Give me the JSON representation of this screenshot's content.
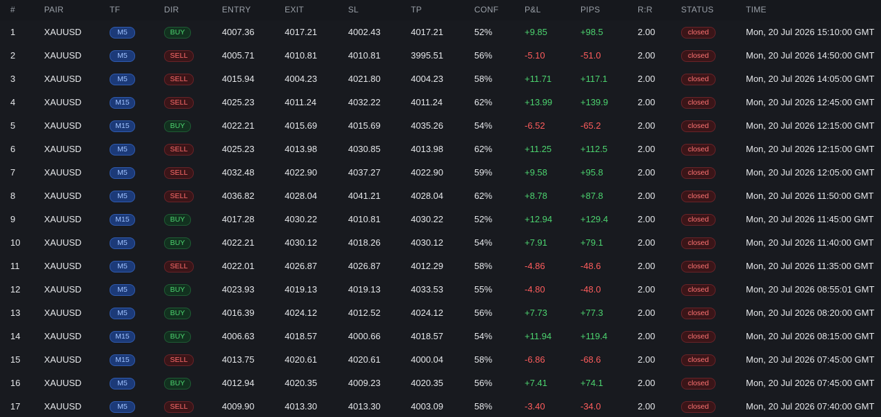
{
  "headers": {
    "num": "#",
    "pair": "PAIR",
    "tf": "TF",
    "dir": "DIR",
    "entry": "ENTRY",
    "exit": "EXIT",
    "sl": "SL",
    "tp": "TP",
    "conf": "CONF",
    "pnl": "P&L",
    "pips": "PIPS",
    "rr": "R:R",
    "status": "STATUS",
    "time": "TIME"
  },
  "colors": {
    "background": "#16181d",
    "positive": "#4cd46f",
    "negative": "#ff5d5d",
    "tf_badge": "#1c3a78",
    "buy_badge": "#12311f",
    "sell_badge": "#3a1518"
  },
  "rows": [
    {
      "num": "1",
      "pair": "XAUUSD",
      "tf": "M5",
      "dir": "BUY",
      "entry": "4007.36",
      "exit": "4017.21",
      "sl": "4002.43",
      "tp": "4017.21",
      "conf": "52%",
      "pnl": "+9.85",
      "pips": "+98.5",
      "rr": "2.00",
      "status": "closed",
      "time": "Mon, 20 Jul 2026 15:10:00 GMT"
    },
    {
      "num": "2",
      "pair": "XAUUSD",
      "tf": "M5",
      "dir": "SELL",
      "entry": "4005.71",
      "exit": "4010.81",
      "sl": "4010.81",
      "tp": "3995.51",
      "conf": "56%",
      "pnl": "-5.10",
      "pips": "-51.0",
      "rr": "2.00",
      "status": "closed",
      "time": "Mon, 20 Jul 2026 14:50:00 GMT"
    },
    {
      "num": "3",
      "pair": "XAUUSD",
      "tf": "M5",
      "dir": "SELL",
      "entry": "4015.94",
      "exit": "4004.23",
      "sl": "4021.80",
      "tp": "4004.23",
      "conf": "58%",
      "pnl": "+11.71",
      "pips": "+117.1",
      "rr": "2.00",
      "status": "closed",
      "time": "Mon, 20 Jul 2026 14:05:00 GMT"
    },
    {
      "num": "4",
      "pair": "XAUUSD",
      "tf": "M15",
      "dir": "SELL",
      "entry": "4025.23",
      "exit": "4011.24",
      "sl": "4032.22",
      "tp": "4011.24",
      "conf": "62%",
      "pnl": "+13.99",
      "pips": "+139.9",
      "rr": "2.00",
      "status": "closed",
      "time": "Mon, 20 Jul 2026 12:45:00 GMT"
    },
    {
      "num": "5",
      "pair": "XAUUSD",
      "tf": "M15",
      "dir": "BUY",
      "entry": "4022.21",
      "exit": "4015.69",
      "sl": "4015.69",
      "tp": "4035.26",
      "conf": "54%",
      "pnl": "-6.52",
      "pips": "-65.2",
      "rr": "2.00",
      "status": "closed",
      "time": "Mon, 20 Jul 2026 12:15:00 GMT"
    },
    {
      "num": "6",
      "pair": "XAUUSD",
      "tf": "M5",
      "dir": "SELL",
      "entry": "4025.23",
      "exit": "4013.98",
      "sl": "4030.85",
      "tp": "4013.98",
      "conf": "62%",
      "pnl": "+11.25",
      "pips": "+112.5",
      "rr": "2.00",
      "status": "closed",
      "time": "Mon, 20 Jul 2026 12:15:00 GMT"
    },
    {
      "num": "7",
      "pair": "XAUUSD",
      "tf": "M5",
      "dir": "SELL",
      "entry": "4032.48",
      "exit": "4022.90",
      "sl": "4037.27",
      "tp": "4022.90",
      "conf": "59%",
      "pnl": "+9.58",
      "pips": "+95.8",
      "rr": "2.00",
      "status": "closed",
      "time": "Mon, 20 Jul 2026 12:05:00 GMT"
    },
    {
      "num": "8",
      "pair": "XAUUSD",
      "tf": "M5",
      "dir": "SELL",
      "entry": "4036.82",
      "exit": "4028.04",
      "sl": "4041.21",
      "tp": "4028.04",
      "conf": "62%",
      "pnl": "+8.78",
      "pips": "+87.8",
      "rr": "2.00",
      "status": "closed",
      "time": "Mon, 20 Jul 2026 11:50:00 GMT"
    },
    {
      "num": "9",
      "pair": "XAUUSD",
      "tf": "M15",
      "dir": "BUY",
      "entry": "4017.28",
      "exit": "4030.22",
      "sl": "4010.81",
      "tp": "4030.22",
      "conf": "52%",
      "pnl": "+12.94",
      "pips": "+129.4",
      "rr": "2.00",
      "status": "closed",
      "time": "Mon, 20 Jul 2026 11:45:00 GMT"
    },
    {
      "num": "10",
      "pair": "XAUUSD",
      "tf": "M5",
      "dir": "BUY",
      "entry": "4022.21",
      "exit": "4030.12",
      "sl": "4018.26",
      "tp": "4030.12",
      "conf": "54%",
      "pnl": "+7.91",
      "pips": "+79.1",
      "rr": "2.00",
      "status": "closed",
      "time": "Mon, 20 Jul 2026 11:40:00 GMT"
    },
    {
      "num": "11",
      "pair": "XAUUSD",
      "tf": "M5",
      "dir": "SELL",
      "entry": "4022.01",
      "exit": "4026.87",
      "sl": "4026.87",
      "tp": "4012.29",
      "conf": "58%",
      "pnl": "-4.86",
      "pips": "-48.6",
      "rr": "2.00",
      "status": "closed",
      "time": "Mon, 20 Jul 2026 11:35:00 GMT"
    },
    {
      "num": "12",
      "pair": "XAUUSD",
      "tf": "M5",
      "dir": "BUY",
      "entry": "4023.93",
      "exit": "4019.13",
      "sl": "4019.13",
      "tp": "4033.53",
      "conf": "55%",
      "pnl": "-4.80",
      "pips": "-48.0",
      "rr": "2.00",
      "status": "closed",
      "time": "Mon, 20 Jul 2026 08:55:01 GMT"
    },
    {
      "num": "13",
      "pair": "XAUUSD",
      "tf": "M5",
      "dir": "BUY",
      "entry": "4016.39",
      "exit": "4024.12",
      "sl": "4012.52",
      "tp": "4024.12",
      "conf": "56%",
      "pnl": "+7.73",
      "pips": "+77.3",
      "rr": "2.00",
      "status": "closed",
      "time": "Mon, 20 Jul 2026 08:20:00 GMT"
    },
    {
      "num": "14",
      "pair": "XAUUSD",
      "tf": "M15",
      "dir": "BUY",
      "entry": "4006.63",
      "exit": "4018.57",
      "sl": "4000.66",
      "tp": "4018.57",
      "conf": "54%",
      "pnl": "+11.94",
      "pips": "+119.4",
      "rr": "2.00",
      "status": "closed",
      "time": "Mon, 20 Jul 2026 08:15:00 GMT"
    },
    {
      "num": "15",
      "pair": "XAUUSD",
      "tf": "M15",
      "dir": "SELL",
      "entry": "4013.75",
      "exit": "4020.61",
      "sl": "4020.61",
      "tp": "4000.04",
      "conf": "58%",
      "pnl": "-6.86",
      "pips": "-68.6",
      "rr": "2.00",
      "status": "closed",
      "time": "Mon, 20 Jul 2026 07:45:00 GMT"
    },
    {
      "num": "16",
      "pair": "XAUUSD",
      "tf": "M5",
      "dir": "BUY",
      "entry": "4012.94",
      "exit": "4020.35",
      "sl": "4009.23",
      "tp": "4020.35",
      "conf": "56%",
      "pnl": "+7.41",
      "pips": "+74.1",
      "rr": "2.00",
      "status": "closed",
      "time": "Mon, 20 Jul 2026 07:45:00 GMT"
    },
    {
      "num": "17",
      "pair": "XAUUSD",
      "tf": "M5",
      "dir": "SELL",
      "entry": "4009.90",
      "exit": "4013.30",
      "sl": "4013.30",
      "tp": "4003.09",
      "conf": "58%",
      "pnl": "-3.40",
      "pips": "-34.0",
      "rr": "2.00",
      "status": "closed",
      "time": "Mon, 20 Jul 2026 07:40:00 GMT"
    }
  ]
}
